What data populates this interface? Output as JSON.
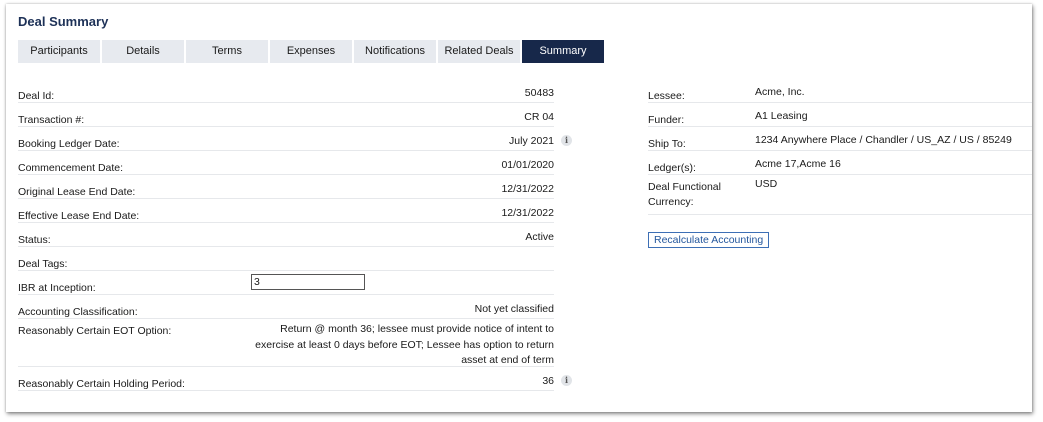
{
  "page_title": "Deal Summary",
  "tabs": [
    {
      "label": "Participants"
    },
    {
      "label": "Details"
    },
    {
      "label": "Terms"
    },
    {
      "label": "Expenses"
    },
    {
      "label": "Notifications"
    },
    {
      "label": "Related Deals"
    },
    {
      "label": "Summary",
      "active": true
    }
  ],
  "left_fields": {
    "deal_id": {
      "label": "Deal Id:",
      "value": "50483"
    },
    "transaction": {
      "label": "Transaction #:",
      "value": "CR 04"
    },
    "booking_ledger_date": {
      "label": "Booking Ledger Date:",
      "value": "July 2021",
      "icon": "info-icon"
    },
    "commencement_date": {
      "label": "Commencement Date:",
      "value": "01/01/2020"
    },
    "original_lease_end_date": {
      "label": "Original Lease End Date:",
      "value": "12/31/2022"
    },
    "effective_lease_end_date": {
      "label": "Effective Lease End Date:",
      "value": "12/31/2022"
    },
    "status": {
      "label": "Status:",
      "value": "Active"
    },
    "deal_tags": {
      "label": "Deal Tags:",
      "value": ""
    },
    "ibr_at_inception": {
      "label": "IBR at Inception:",
      "value": "3"
    },
    "accounting_classification": {
      "label": "Accounting Classification:",
      "value": "Not yet classified"
    },
    "eot_option": {
      "label": "Reasonably Certain EOT Option:",
      "value": "Return @ month 36; lessee must provide notice of intent to exercise at least 0 days before EOT; Lessee has option to return asset at end of term"
    },
    "holding_period": {
      "label": "Reasonably Certain Holding Period:",
      "value": "36",
      "icon": "info-icon"
    }
  },
  "right_fields": {
    "lessee": {
      "label": "Lessee:",
      "value": "Acme, Inc."
    },
    "funder": {
      "label": "Funder:",
      "value": "A1 Leasing"
    },
    "ship_to": {
      "label": "Ship To:",
      "value": "1234 Anywhere Place / Chandler / US_AZ / US / 85249"
    },
    "ledgers": {
      "label": "Ledger(s):",
      "value": "Acme 17,Acme 16"
    },
    "functional_currency": {
      "label": "Deal Functional Currency:",
      "value": "USD"
    }
  },
  "recalculate_button": "Recalculate Accounting",
  "info_glyph": "i",
  "colors": {
    "title": "#1d3157",
    "active_tab": "#17284a",
    "inactive_tab": "#e7eaef",
    "button_border": "#3d6fb5"
  }
}
